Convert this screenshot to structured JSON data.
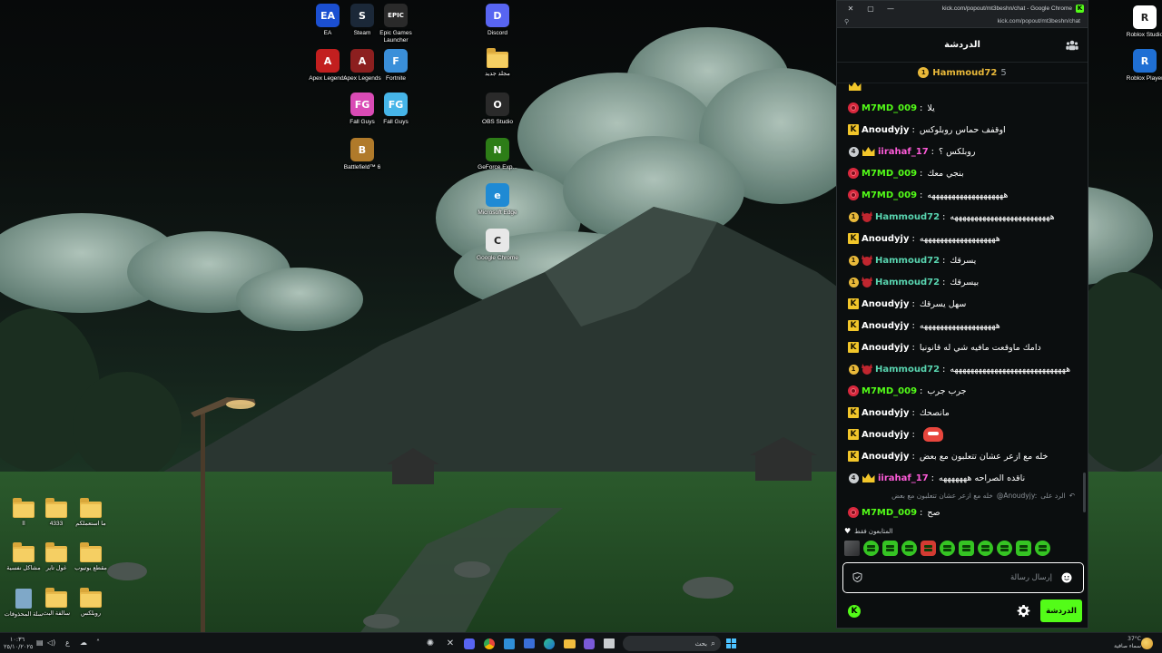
{
  "desktop": {
    "icons": [
      {
        "label": "EA",
        "color": "#1b4fd1",
        "glyph": "EA"
      },
      {
        "label": "Steam",
        "color": "#1b2838",
        "glyph": "S"
      },
      {
        "label": "Epic Games Launcher",
        "color": "#2a2a2a",
        "glyph": "EPIC"
      },
      {
        "label": "Discord",
        "color": "#5865f2",
        "glyph": "D"
      },
      {
        "label": "Apex Legends",
        "color": "#c21f1f",
        "glyph": "A"
      },
      {
        "label": "Apex Legends",
        "color": "#8c1f1f",
        "glyph": "A"
      },
      {
        "label": "Fortnite",
        "color": "#3a8fd9",
        "glyph": "F"
      },
      {
        "label": "مجلد جديد",
        "color": "#e8b94a",
        "glyph": ""
      },
      {
        "label": "Fall Guys",
        "color": "#d94bb5",
        "glyph": "FG"
      },
      {
        "label": "Fall Guys",
        "color": "#46b5e8",
        "glyph": "FG"
      },
      {
        "label": "OBS Studio",
        "color": "#2a2a2a",
        "glyph": "O"
      },
      {
        "label": "Battlefield™ 6",
        "color": "#b07a2a",
        "glyph": "B"
      },
      {
        "label": "GeForce Exp...",
        "color": "#2d7d17",
        "glyph": "N"
      },
      {
        "label": "Microsoft Edge",
        "color": "#1f8ad4",
        "glyph": "e"
      },
      {
        "label": "Google Chrome",
        "color": "#e8e8e8",
        "glyph": "C"
      },
      {
        "label": "Roblox Studio",
        "color": "#ffffff",
        "glyph": "R"
      },
      {
        "label": "Roblox Player",
        "color": "#1f6fd4",
        "glyph": "R"
      }
    ],
    "folders": [
      {
        "label": "ما استعملكم"
      },
      {
        "label": "4333"
      },
      {
        "label": "اا"
      },
      {
        "label": "مقطع يوتيوب"
      },
      {
        "label": "غول تاير"
      },
      {
        "label": "مشاكل نفسية"
      },
      {
        "label": "روبلكس"
      },
      {
        "label": "سالفة البث"
      },
      {
        "label": "سلة المحذوفات"
      }
    ]
  },
  "chat_window": {
    "title": "kick.com/popout/mt3beshn/chat - Google Chrome",
    "url": "kick.com/popout/mt3beshn/chat",
    "header_title": "الدردشة",
    "pinned": {
      "badge": "1",
      "name": "Hammoud72",
      "count": "5"
    },
    "messages": [
      {
        "badges": [
          "crown"
        ],
        "name": "",
        "color": "#e9b93a",
        "text": "",
        "partial": true
      },
      {
        "badges": [
          "red"
        ],
        "name": "M7MD_009",
        "color": "#53fc18",
        "text": "يلا"
      },
      {
        "badges": [
          "k"
        ],
        "name": "Anoudyjy",
        "color": "#ffffff",
        "text": "اوقفف حماس روبلوكس"
      },
      {
        "badges": [
          "gray4",
          "crown"
        ],
        "name": "iirahaf_17",
        "color": "#ff5bd9",
        "text": "روبلكس ؟"
      },
      {
        "badges": [
          "red"
        ],
        "name": "M7MD_009",
        "color": "#53fc18",
        "text": "بنجي معك"
      },
      {
        "badges": [
          "red"
        ],
        "name": "M7MD_009",
        "color": "#53fc18",
        "text": "هههههههههههههههههههه"
      },
      {
        "badges": [
          "sub1",
          "devil"
        ],
        "name": "Hammoud72",
        "color": "#59d5b0",
        "text": "هههههههههههههههههههههههههه"
      },
      {
        "badges": [
          "k"
        ],
        "name": "Anoudyjy",
        "color": "#ffffff",
        "text": "هههههههههههههههههههه"
      },
      {
        "badges": [
          "sub1",
          "devil"
        ],
        "name": "Hammoud72",
        "color": "#59d5b0",
        "text": "يسرقك"
      },
      {
        "badges": [
          "sub1",
          "devil"
        ],
        "name": "Hammoud72",
        "color": "#59d5b0",
        "text": "بيسرقك"
      },
      {
        "badges": [
          "k"
        ],
        "name": "Anoudyjy",
        "color": "#ffffff",
        "text": "سهل يسرقك"
      },
      {
        "badges": [
          "k"
        ],
        "name": "Anoudyjy",
        "color": "#ffffff",
        "text": "هههههههههههههههههههه"
      },
      {
        "badges": [
          "k"
        ],
        "name": "Anoudyjy",
        "color": "#ffffff",
        "text": "دامك ماوقعت مافيه شي له قانونيا"
      },
      {
        "badges": [
          "sub1",
          "devil"
        ],
        "name": "Hammoud72",
        "color": "#59d5b0",
        "text": "هههههههههههههههههههههههههههههه"
      },
      {
        "badges": [
          "red"
        ],
        "name": "M7MD_009",
        "color": "#53fc18",
        "text": "جرب جرب"
      },
      {
        "badges": [
          "k"
        ],
        "name": "Anoudyjy",
        "color": "#ffffff",
        "text": "مانصحك"
      },
      {
        "badges": [
          "k"
        ],
        "name": "Anoudyjy",
        "color": "#ffffff",
        "text": "",
        "emote": "emote-face"
      },
      {
        "badges": [
          "k"
        ],
        "name": "Anoudyjy",
        "color": "#ffffff",
        "text": "خله مع ازعر عشان تتعلبون مع بعض"
      },
      {
        "badges": [
          "gray4",
          "crown"
        ],
        "name": "iirahaf_17",
        "color": "#ff5bd9",
        "text": "ناقده الصراحه هههههههه"
      }
    ],
    "reply": {
      "prefix": "الرد على",
      "name": "@Anoudyjy:",
      "text": "خله مع ازعر عشان تتعلبون مع بعض"
    },
    "last_message": {
      "name": "M7MD_009",
      "color": "#53fc18",
      "text": "صح"
    },
    "followers_only": "المتابعون فقط",
    "input_placeholder": "إرسال رسالة",
    "send_label": "الدردشة",
    "accent": "#53fc18"
  },
  "taskbar": {
    "search_label": "بحث",
    "weather_temp": "37°C",
    "weather_desc": "سماء صافية",
    "clock_time": "١٠:٣٦",
    "clock_date": "٢٥/١٠/٢٠٢٥",
    "lang": "ع"
  }
}
